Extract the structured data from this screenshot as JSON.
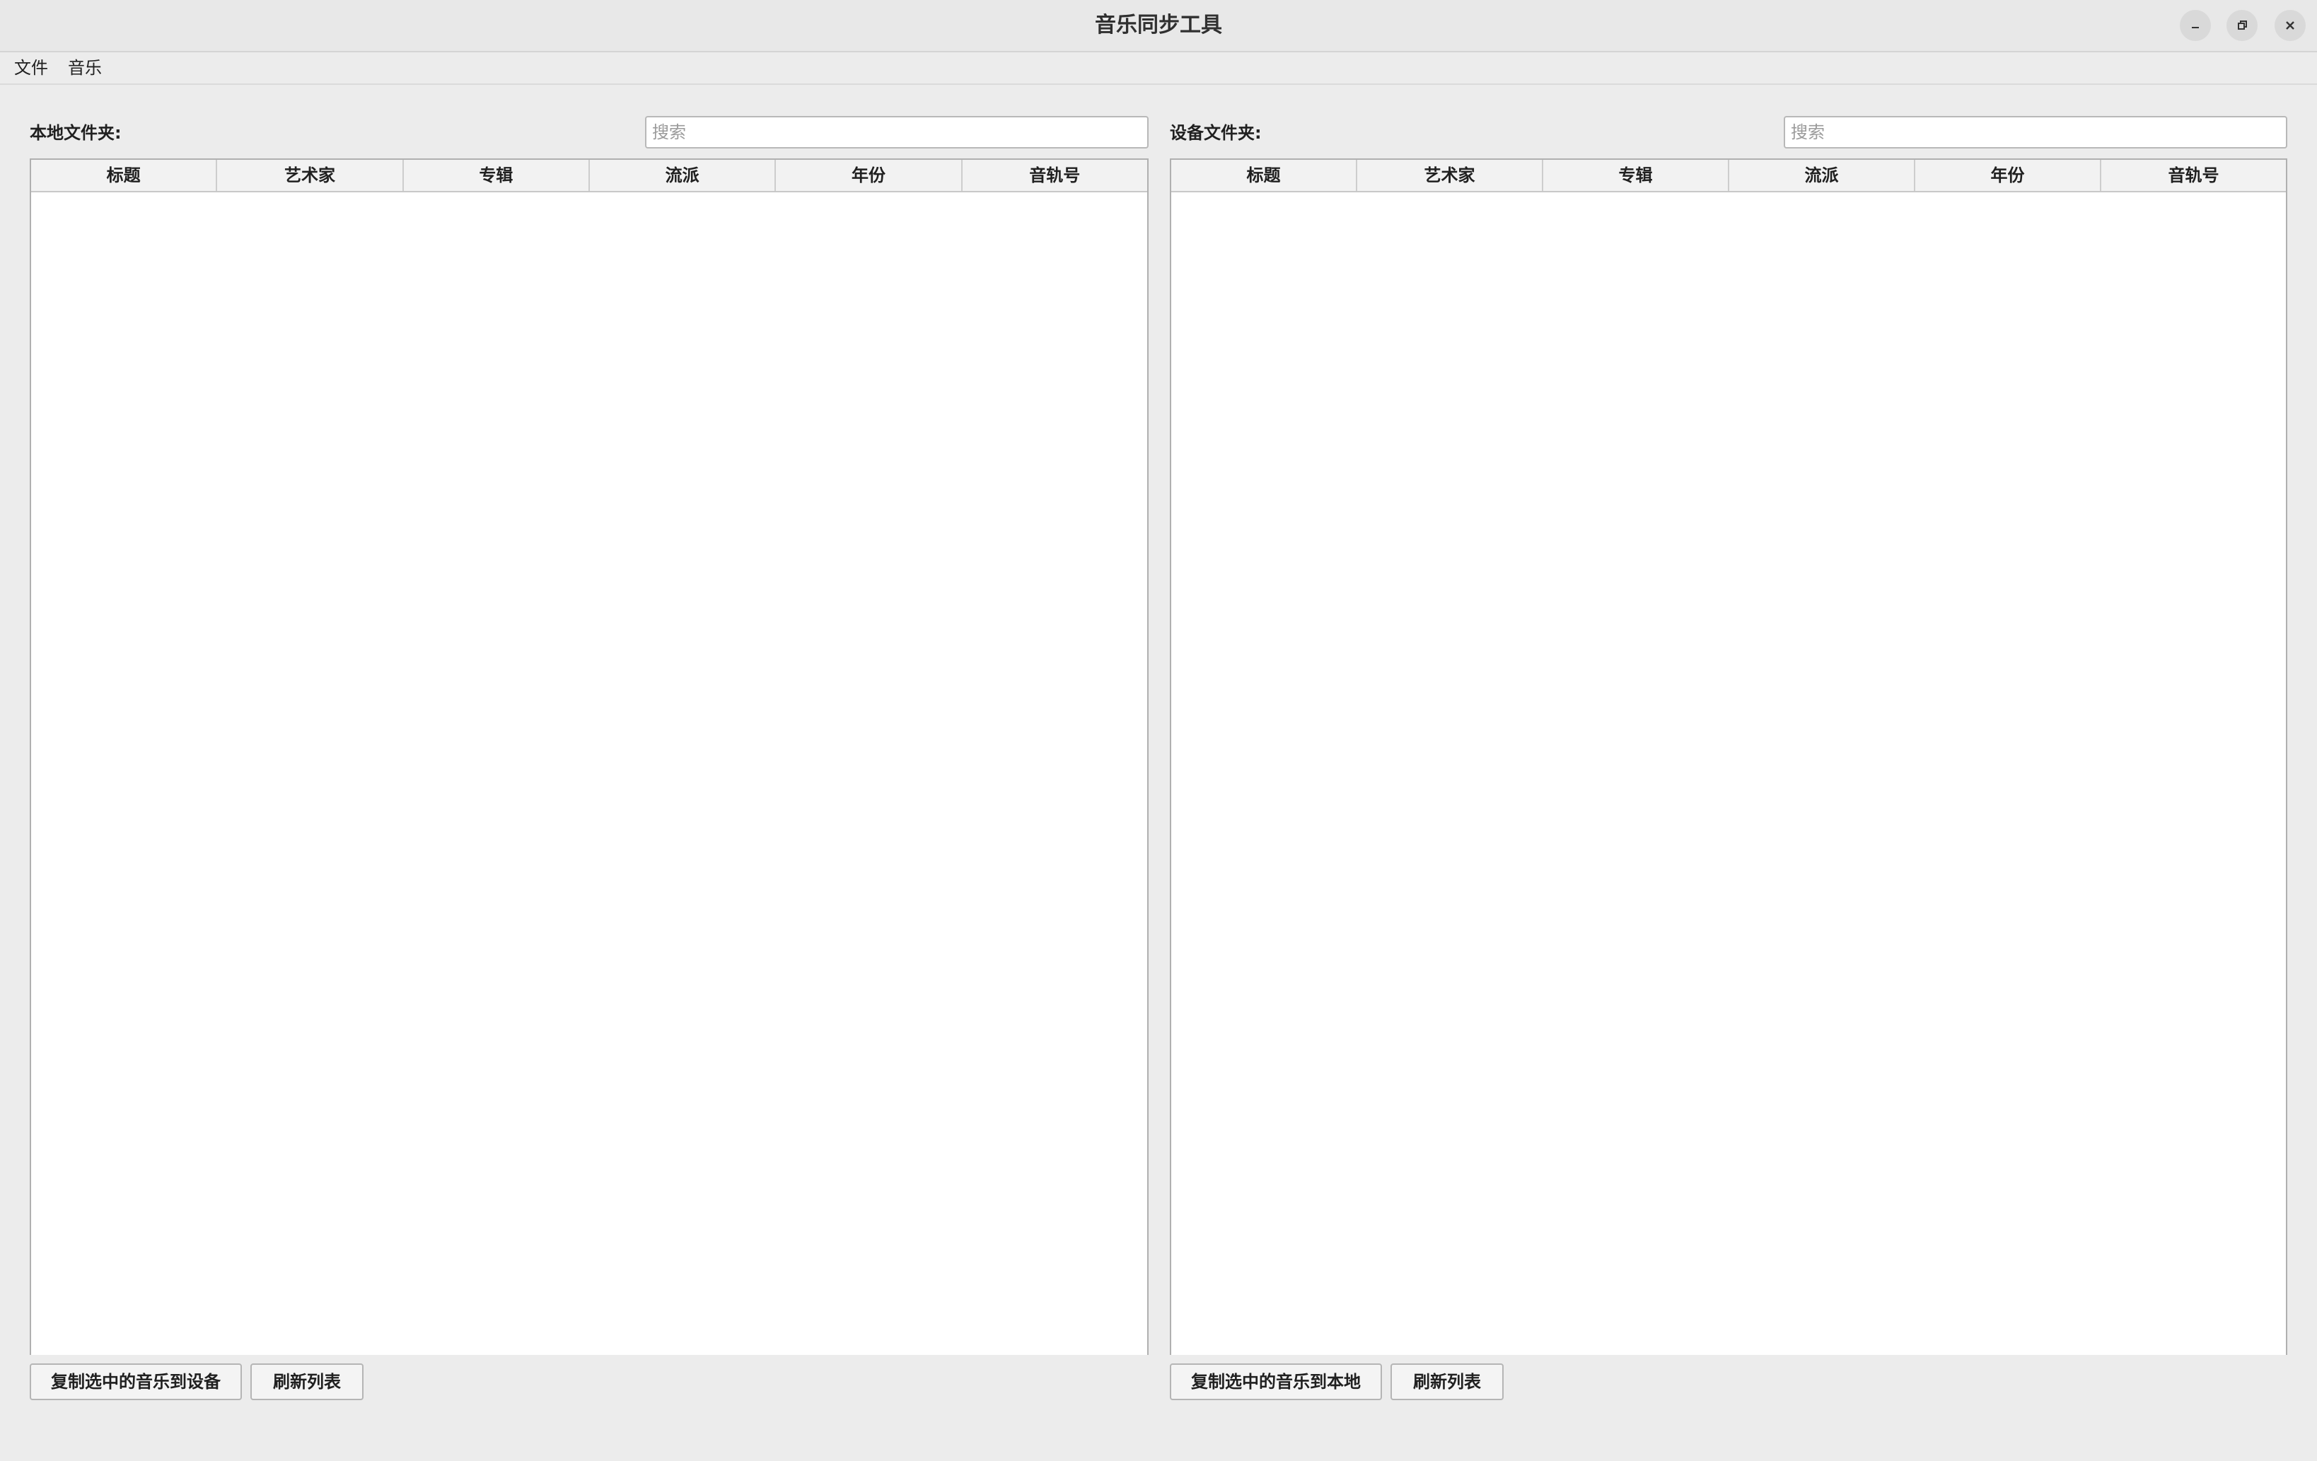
{
  "window": {
    "title": "音乐同步工具"
  },
  "menu": {
    "items": [
      "文件",
      "音乐"
    ]
  },
  "left_panel": {
    "folder_label": "本地文件夹:",
    "search_placeholder": "搜索",
    "columns": [
      "标题",
      "艺术家",
      "专辑",
      "流派",
      "年份",
      "音轨号"
    ],
    "rows": [],
    "copy_button": "复制选中的音乐到设备",
    "refresh_button": "刷新列表"
  },
  "right_panel": {
    "folder_label": "设备文件夹:",
    "search_placeholder": "搜索",
    "columns": [
      "标题",
      "艺术家",
      "专辑",
      "流派",
      "年份",
      "音轨号"
    ],
    "rows": [],
    "copy_button": "复制选中的音乐到本地",
    "refresh_button": "刷新列表"
  }
}
